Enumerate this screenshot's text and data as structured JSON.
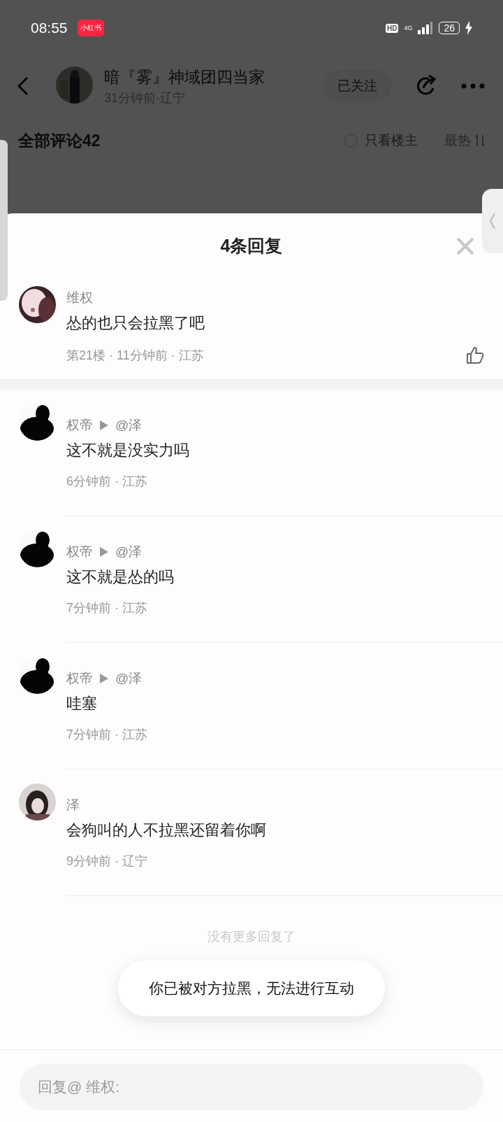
{
  "status_bar": {
    "time": "08:55",
    "app_badge": "小红书",
    "hd": "HD",
    "network": "4G",
    "battery": "26"
  },
  "post_header": {
    "author": "暗『雾』神域团四当家",
    "meta": "31分钟前·辽宁",
    "follow_button": "已关注"
  },
  "comments_bar": {
    "title": "全部评论42",
    "author_only": {
      "label": "只看楼主",
      "checked": false
    },
    "sort": "最热"
  },
  "reply_sheet": {
    "title": "4条回复",
    "main_comment": {
      "author": "维权",
      "text": "怂的也只会拉黑了吧",
      "meta": "第21楼 · 11分钟前 · 江苏"
    },
    "replies": [
      {
        "author": "权帝",
        "reply_to": "@泽",
        "text": "这不就是没实力吗",
        "meta": "6分钟前 · 江苏"
      },
      {
        "author": "权帝",
        "reply_to": "@泽",
        "text": "这不就是怂的吗",
        "meta": "7分钟前 · 江苏"
      },
      {
        "author": "权帝",
        "reply_to": "@泽",
        "text": "哇塞",
        "meta": "7分钟前 · 江苏"
      },
      {
        "author": "泽",
        "text": "会狗叫的人不拉黑还留着你啊",
        "meta": "9分钟前 · 辽宁"
      }
    ],
    "end_note": "没有更多回复了",
    "toast": "你已被对方拉黑，无法进行互动",
    "reply_input": {
      "placeholder": "回复@ 维权:"
    }
  }
}
